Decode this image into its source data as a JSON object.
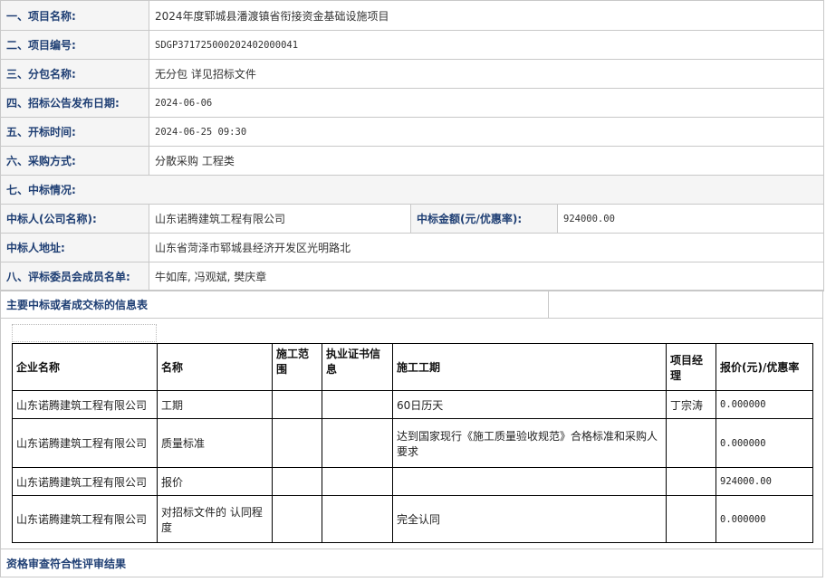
{
  "rows": [
    {
      "label": "一、项目名称:",
      "value": "2024年度郓城县潘渡镇省衔接资金基础设施项目"
    },
    {
      "label": "二、项目编号:",
      "value": "SDGP371725000202402000041"
    },
    {
      "label": "三、分包名称:",
      "value": "无分包 详见招标文件"
    },
    {
      "label": "四、招标公告发布日期:",
      "value": "2024-06-06"
    },
    {
      "label": "五、开标时间:",
      "value": "2024-06-25 09:30"
    },
    {
      "label": "六、采购方式:",
      "value": "分散采购 工程类"
    }
  ],
  "section7": {
    "label": "七、中标情况:"
  },
  "winner": {
    "name_label": "中标人(公司名称):",
    "name_value": "山东诺腾建筑工程有限公司",
    "amount_label": "中标金额(元/优惠率):",
    "amount_value": "924000.00",
    "address_label": "中标人地址:",
    "address_value": "山东省菏泽市郓城县经济开发区光明路北"
  },
  "committee": {
    "label": "八、评标委员会成员名单:",
    "value": "牛如库, 冯观斌, 樊庆章"
  },
  "info_table": {
    "title": "主要中标或者成交标的信息表",
    "headers": [
      "企业名称",
      "名称",
      "施工范围",
      "执业证书信息",
      "施工工期",
      "项目经理",
      "报价(元)/优惠率"
    ],
    "rows": [
      [
        "山东诺腾建筑工程有限公司",
        "工期",
        "",
        "",
        "60日历天",
        "丁宗涛",
        "0.000000"
      ],
      [
        "山东诺腾建筑工程有限公司",
        "质量标准",
        "",
        "",
        "达到国家现行《施工质量验收规范》合格标准和采购人要求",
        "",
        "0.000000"
      ],
      [
        "山东诺腾建筑工程有限公司",
        "报价",
        "",
        "",
        "",
        "",
        "924000.00"
      ],
      [
        "山东诺腾建筑工程有限公司",
        "对招标文件的 认同程度",
        "",
        "",
        "完全认同",
        "",
        "0.000000"
      ]
    ]
  },
  "footer": {
    "title": "资格审查符合性评审结果"
  }
}
